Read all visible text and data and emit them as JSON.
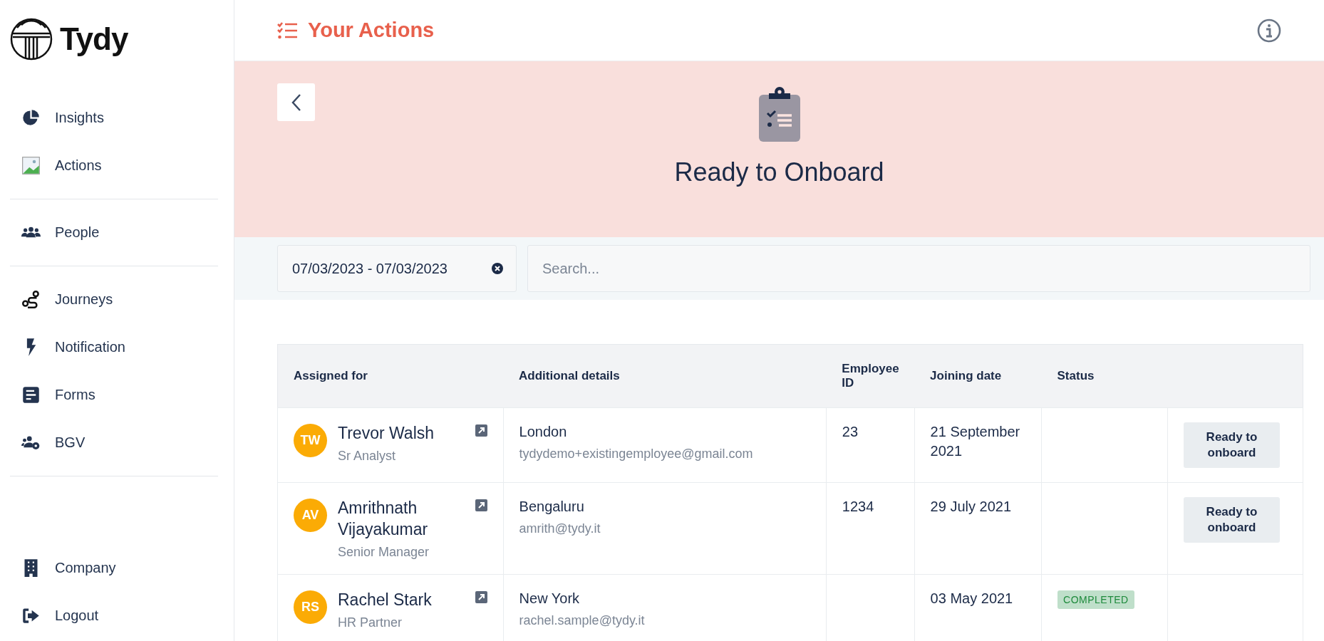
{
  "sidebar": {
    "logo": "Tydy",
    "groups": [
      [
        {
          "label": "Insights",
          "kind": "pie"
        },
        {
          "label": "Actions",
          "kind": "image"
        }
      ],
      [
        {
          "label": "People",
          "kind": "people"
        }
      ],
      [
        {
          "label": "Journeys",
          "kind": "route"
        },
        {
          "label": "Notification",
          "kind": "bolt"
        },
        {
          "label": "Forms",
          "kind": "form"
        },
        {
          "label": "BGV",
          "kind": "usergear"
        }
      ]
    ],
    "bottom": [
      {
        "label": "Company",
        "kind": "building"
      },
      {
        "label": "Logout",
        "kind": "logout"
      }
    ]
  },
  "header": {
    "title": "Your Actions"
  },
  "banner": {
    "title": "Ready to Onboard"
  },
  "filters": {
    "date_range": "07/03/2023 - 07/03/2023",
    "search": {
      "placeholder": "Search..."
    }
  },
  "table": {
    "columns": [
      "Assigned for",
      "Additional details",
      "Employee ID",
      "Joining date",
      "Status"
    ],
    "rows": [
      {
        "initials": "TW",
        "name": "Trevor Walsh",
        "role": "Sr Analyst",
        "location": "London",
        "email": "tydydemo+existingemployee@gmail.com",
        "employee_id": "23",
        "joining_date": "21 September 2021",
        "action": "Ready to onboard"
      },
      {
        "initials": "AV",
        "name": "Amrithnath Vijayakumar",
        "role": "Senior Manager",
        "location": "Bengaluru",
        "email": "amrith@tydy.it",
        "employee_id": "1234",
        "joining_date": "29 July 2021",
        "action": "Ready to onboard"
      },
      {
        "initials": "RS",
        "name": "Rachel Stark",
        "role": "HR Partner",
        "location": "New York",
        "email": "rachel.sample@tydy.it",
        "joining_date": "03 May 2021",
        "status": "COMPLETED"
      }
    ]
  }
}
